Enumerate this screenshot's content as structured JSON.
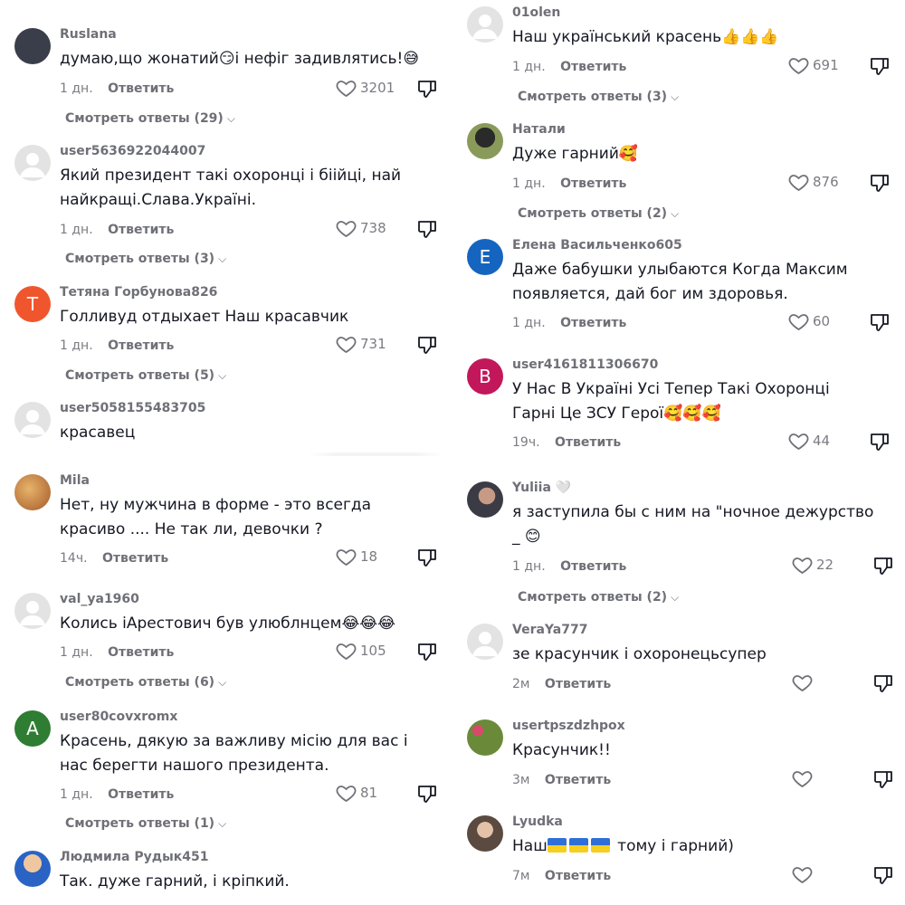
{
  "left": [
    {
      "user": "Ruslana",
      "text": "думаю,що жонатий😏і нефіг задивлятись!😅",
      "time": "1 дн.",
      "reply": "Ответить",
      "likes": "3201",
      "replies": "Смотреть ответы (29)",
      "avatar": {
        "type": "photo",
        "color": "#3a3e4a"
      }
    },
    {
      "user": "user5636922044007",
      "text": "Який президент такі охоронці і біійці, най найкращі.Слава.Україні.",
      "time": "1 дн.",
      "reply": "Ответить",
      "likes": "738",
      "replies": "Смотреть ответы (3)",
      "avatar": {
        "type": "default"
      }
    },
    {
      "user": "Тетяна Горбунова826",
      "text": "Голливуд отдыхает Наш красавчик",
      "time": "1 дн.",
      "reply": "Ответить",
      "likes": "731",
      "replies": "Смотреть ответы (5)",
      "avatar": {
        "type": "letter",
        "letter": "Т",
        "color": "#f0562d"
      }
    },
    {
      "user": "user5058155483705",
      "text": "красавец",
      "avatar": {
        "type": "default"
      }
    },
    {
      "user": "Mila",
      "text": "Нет, ну мужчина в форме - это всегда красиво .... Не так ли, девочки ?",
      "time": "14ч.",
      "reply": "Ответить",
      "likes": "18",
      "avatar": {
        "type": "photo",
        "color": "#c8843f"
      }
    },
    {
      "user": "val_ya1960",
      "text": "Колись іАрестович був улюблнцем😂😂😂",
      "time": "1 дн.",
      "reply": "Ответить",
      "likes": "105",
      "replies": "Смотреть ответы (6)",
      "avatar": {
        "type": "default"
      }
    },
    {
      "user": "user80covxromx",
      "text": "Красень, дякую за важливу місію для вас і нас берегти нашого президента.",
      "time": "1 дн.",
      "reply": "Ответить",
      "likes": "81",
      "replies": "Смотреть ответы (1)",
      "avatar": {
        "type": "letter",
        "letter": "A",
        "color": "#2e7d32"
      }
    },
    {
      "user": "Людмила Рудык451",
      "text": "Так. дуже гарний, і кріпкий.",
      "avatar": {
        "type": "photo",
        "color": "#2a63c4"
      }
    }
  ],
  "right": [
    {
      "user": "01olen",
      "text": "Наш український красень👍👍👍",
      "time": "1 дн.",
      "reply": "Ответить",
      "likes": "691",
      "replies": "Смотреть ответы (3)",
      "avatar": {
        "type": "default"
      }
    },
    {
      "user": "Натали",
      "text": "Дуже гарний🥰",
      "time": "1 дн.",
      "reply": "Ответить",
      "likes": "876",
      "replies": "Смотреть ответы (2)",
      "avatar": {
        "type": "photo",
        "color": "#4a5a2a"
      }
    },
    {
      "user": "Елена Васильченко605",
      "text": "Даже бабушки улыбаются Когда Максим появляется, дай бог им здоровья.",
      "time": "1 дн.",
      "reply": "Ответить",
      "likes": "60",
      "avatar": {
        "type": "letter",
        "letter": "E",
        "color": "#1565c0"
      }
    },
    {
      "user": "user4161811306670",
      "text": "У Нас В Україні Усі Тепер Такі Охоронці Гарні Це ЗСУ Герої🥰🥰🥰",
      "time": "19ч.",
      "reply": "Ответить",
      "likes": "44",
      "avatar": {
        "type": "letter",
        "letter": "B",
        "color": "#c2185b"
      }
    },
    {
      "user": "Yuliia 🤍",
      "text": "я заступила бы с ним на \"ночное дежурство _ 😊",
      "time": "1 дн.",
      "reply": "Ответить",
      "likes": "22",
      "replies": "Смотреть ответы (2)",
      "avatar": {
        "type": "photo",
        "color": "#3b3b45"
      }
    },
    {
      "user": "VeraYa777",
      "text": "зе красунчик і охоронецьсупер",
      "time": "2м",
      "reply": "Ответить",
      "avatar": {
        "type": "default"
      }
    },
    {
      "user": "usertpszdzhpox",
      "text": "Красунчик!!",
      "time": "3м",
      "reply": "Ответить",
      "avatar": {
        "type": "photo",
        "color": "#6a8a3a"
      }
    },
    {
      "user": "Lyudka",
      "text_before": "Наш",
      "text_after": " тому і гарний)",
      "time": "7м",
      "reply": "Ответить",
      "avatar": {
        "type": "photo",
        "color": "#5a4a40"
      }
    }
  ]
}
